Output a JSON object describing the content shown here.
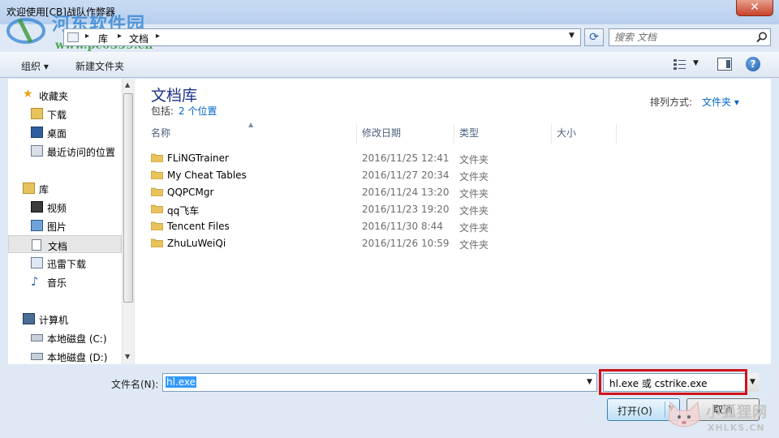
{
  "window": {
    "title": "欢迎使用[CB]战队作弊器",
    "close_label": "✕"
  },
  "watermark": {
    "site_name": "河东软件园",
    "site_url": "www.pc0359.cn",
    "corner_text": "小狐狸网",
    "corner_url": "XHLKS.CN"
  },
  "address": {
    "crumbs": [
      "库",
      "文档"
    ]
  },
  "search": {
    "placeholder": "搜索 文档"
  },
  "toolbar": {
    "organize_label": "组织 ▾",
    "new_folder_label": "新建文件夹",
    "help_label": "?"
  },
  "nav": {
    "favorites": {
      "label": "收藏夹",
      "items": [
        "下载",
        "桌面",
        "最近访问的位置"
      ]
    },
    "libraries": {
      "label": "库",
      "items": [
        "视频",
        "图片",
        "文档",
        "迅雷下载",
        "音乐"
      ]
    },
    "computer": {
      "label": "计算机",
      "items": [
        "本地磁盘 (C:)",
        "本地磁盘 (D:)"
      ]
    },
    "selected": "文档"
  },
  "library": {
    "title": "文档库",
    "includes_label": "包括:",
    "locations_link": "2 个位置",
    "arrange_label": "排列方式:",
    "arrange_value": "文件夹 ▾"
  },
  "columns": {
    "name": "名称",
    "date": "修改日期",
    "type": "类型",
    "size": "大小"
  },
  "files": [
    {
      "name": "FLiNGTrainer",
      "date": "2016/11/25 12:41",
      "type": "文件夹"
    },
    {
      "name": "My Cheat Tables",
      "date": "2016/11/27 20:34",
      "type": "文件夹"
    },
    {
      "name": "QQPCMgr",
      "date": "2016/11/24 13:20",
      "type": "文件夹"
    },
    {
      "name": "qq飞车",
      "date": "2016/11/23 19:20",
      "type": "文件夹"
    },
    {
      "name": "Tencent Files",
      "date": "2016/11/30 8:44",
      "type": "文件夹"
    },
    {
      "name": "ZhuLuWeiQi",
      "date": "2016/11/26 10:59",
      "type": "文件夹"
    }
  ],
  "bottom": {
    "filename_label": "文件名(N):",
    "filename_value": "hl.exe",
    "filetype_value": "hl.exe 或 cstrike.exe",
    "open_label": "打开(O)",
    "cancel_label": "取消"
  },
  "colors": {
    "accent": "#0066cc",
    "highlight_box": "#d0121a",
    "selection": "#3399ff"
  }
}
